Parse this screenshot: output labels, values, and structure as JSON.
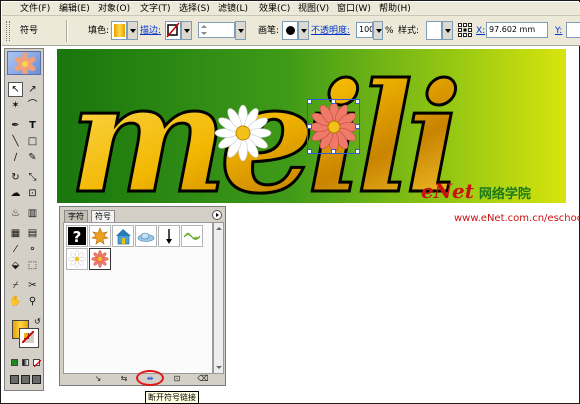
{
  "menu": [
    "文件(F)",
    "编辑(E)",
    "对象(O)",
    "文字(T)",
    "选择(S)",
    "滤镜(L)",
    "效果(C)",
    "视图(V)",
    "窗口(W)",
    "帮助(H)"
  ],
  "control_bar": {
    "selection_label": "符号",
    "fill_label": "填色:",
    "stroke_label": "描边:",
    "brush_label": "画笔:",
    "opacity_label": "不透明度:",
    "opacity_value": "100",
    "opacity_unit": "%",
    "style_label": "样式:",
    "x_label": "X:",
    "x_value": "97.602 mm",
    "y_label": "Y:",
    "fill_color": "#f5b800",
    "stroke_color": "#cc0000"
  },
  "artwork": {
    "text": "meili",
    "bg_dark": "#18760d",
    "bg_light": "#d8e40c",
    "letter_color": "#f2c200"
  },
  "symbols_panel": {
    "tabs": [
      "字符",
      "符号"
    ],
    "active_tab": "符号"
  },
  "tooltip": "断开符号链接",
  "watermark": {
    "logo": "eNet",
    "chinese": "网络学院",
    "url": "www.eNet.com.cn/eschool"
  },
  "icons": [
    "pointer-icon",
    "direct-select-icon",
    "magic-wand-icon",
    "lasso-icon",
    "pen-icon",
    "type-icon",
    "line-icon",
    "rectangle-icon",
    "paintbrush-icon",
    "pencil-icon",
    "rotate-icon",
    "scale-icon",
    "warp-icon",
    "free-transform-icon",
    "symbol-sprayer-icon",
    "column-graph-icon",
    "mesh-icon",
    "gradient-icon",
    "eyedropper-icon",
    "blend-icon",
    "live-paint-icon",
    "live-paint-select-icon",
    "slice-icon",
    "scissors-icon",
    "hand-icon",
    "zoom-icon",
    "fill-stroke-icon",
    "color-mode-icon",
    "screen-mode-icon"
  ]
}
